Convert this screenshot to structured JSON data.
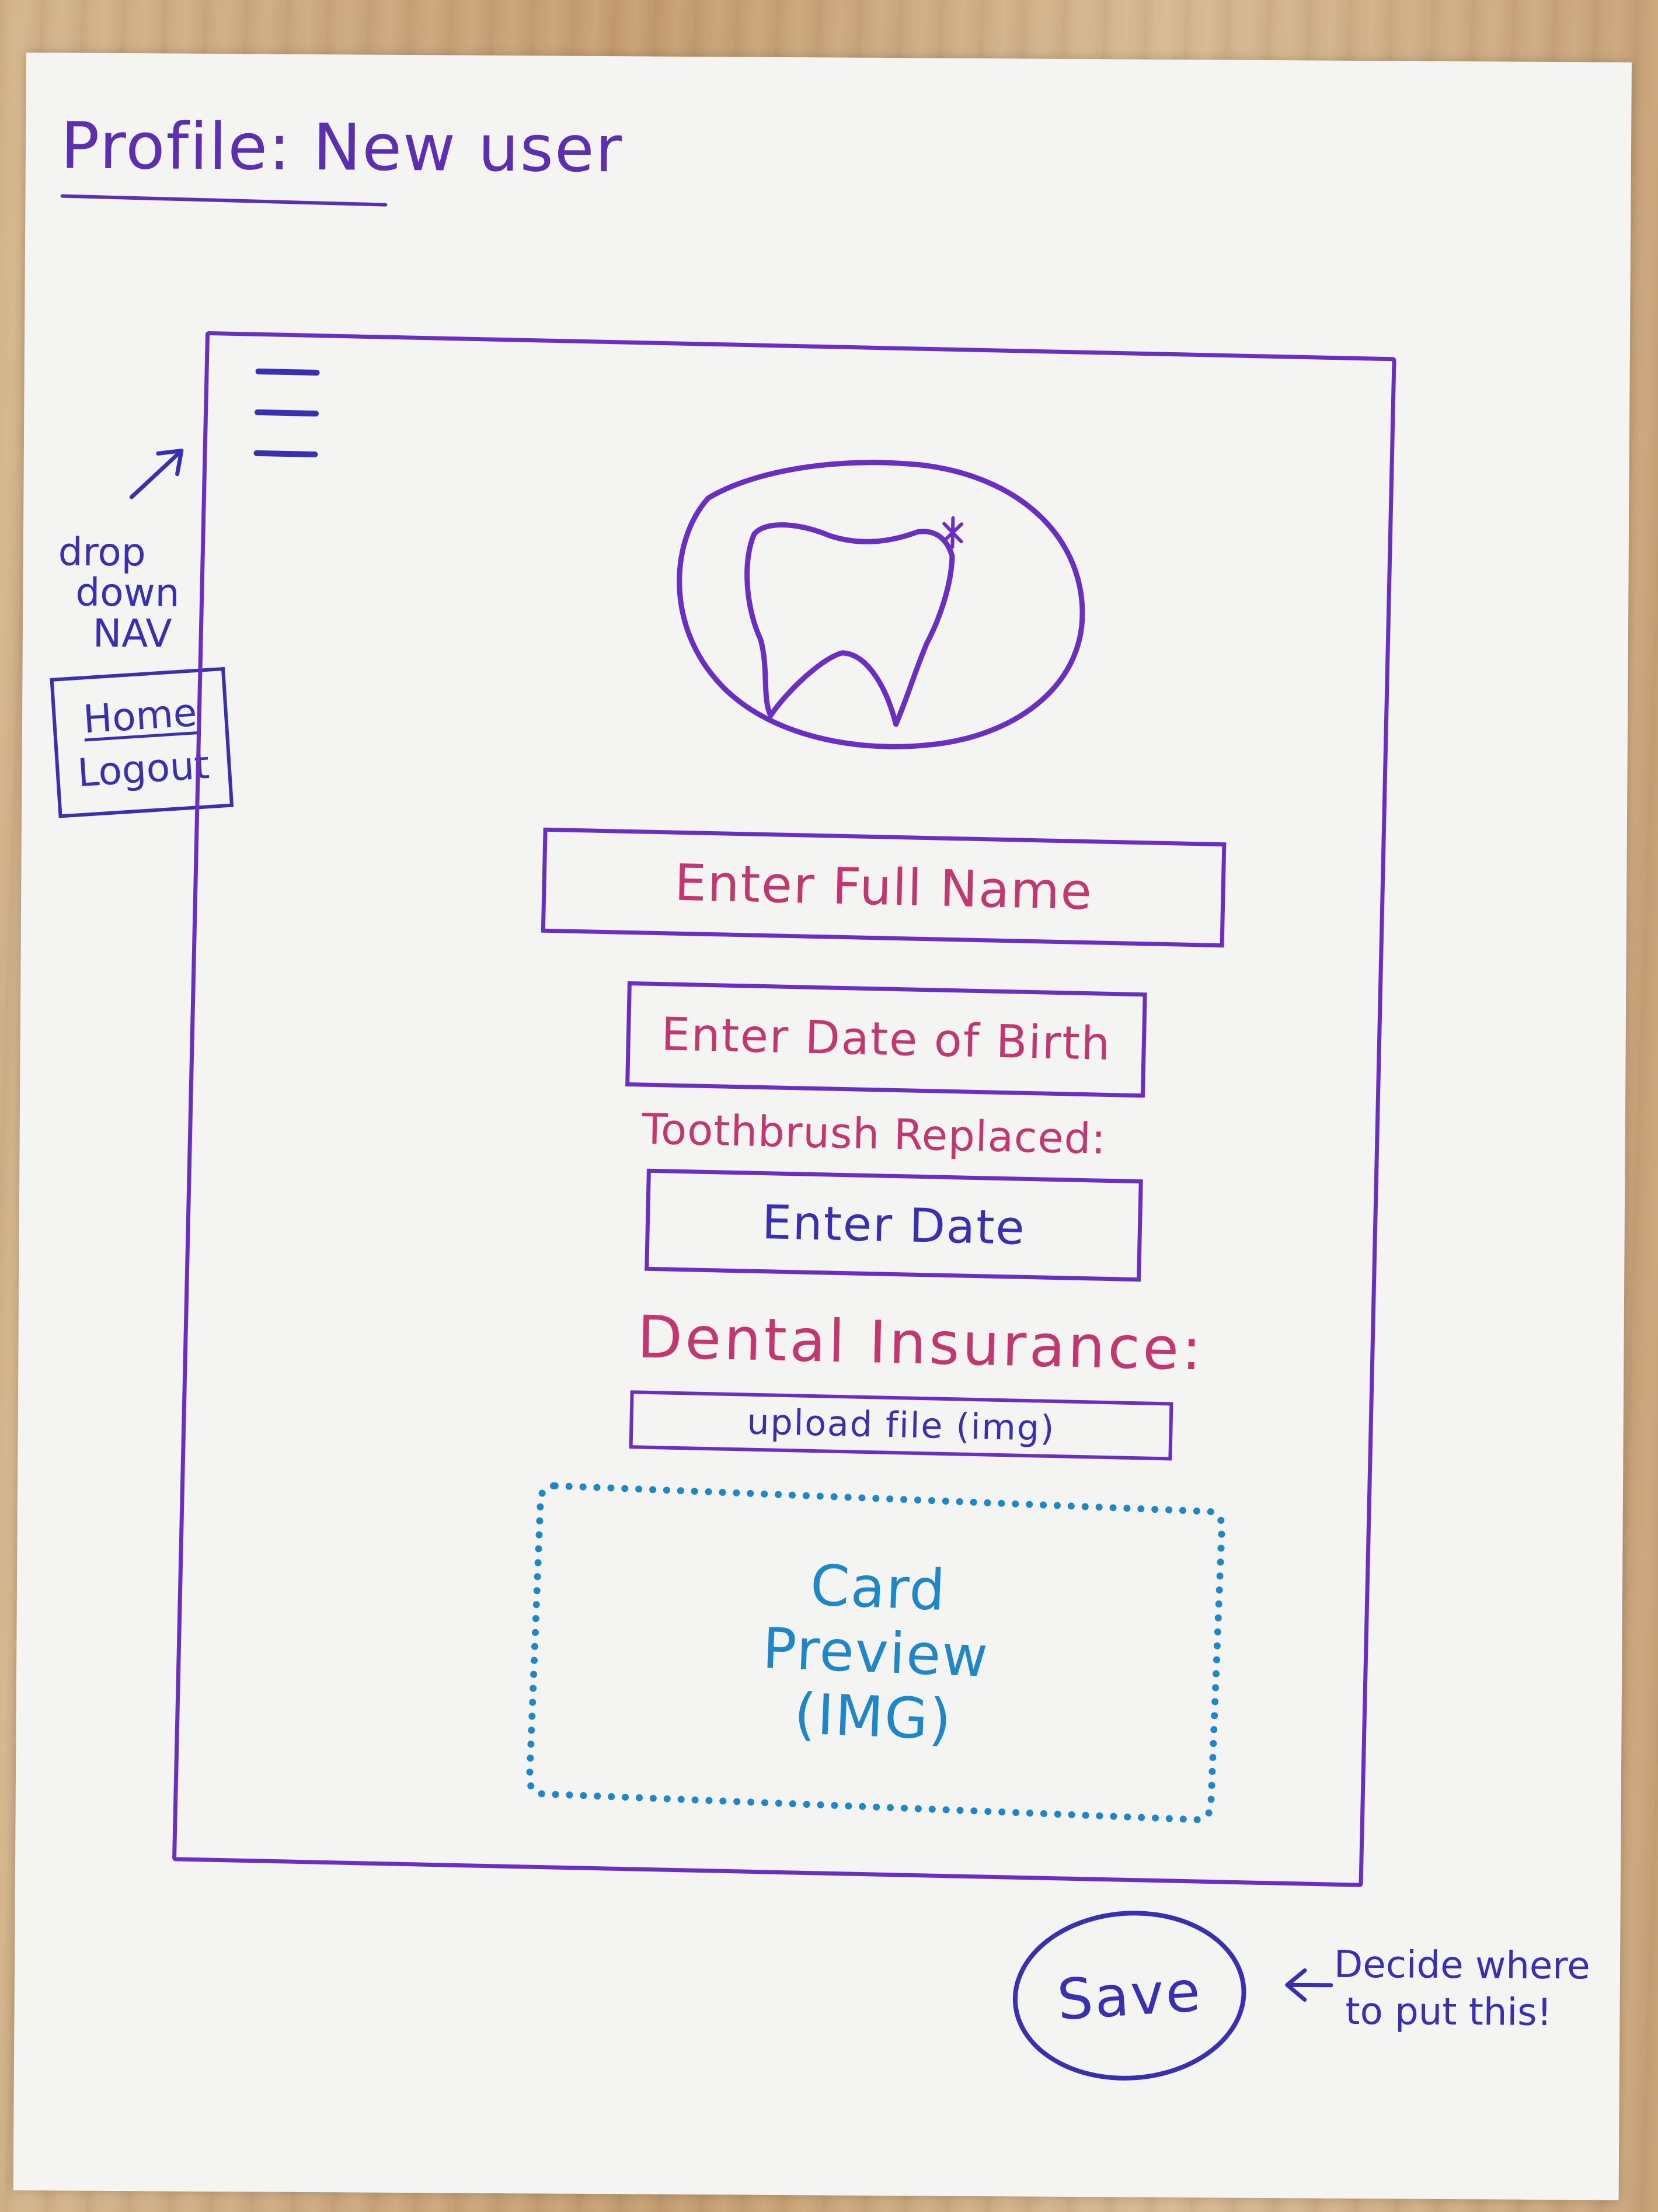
{
  "page": {
    "title": "Profile: New user"
  },
  "header": {
    "menu_icon": "hamburger-icon"
  },
  "logo": {
    "icon": "tooth-icon"
  },
  "form": {
    "full_name_placeholder": "Enter Full Name",
    "dob_placeholder": "Enter Date of Birth",
    "toothbrush_label": "Toothbrush Replaced:",
    "toothbrush_date_placeholder": "Enter Date",
    "insurance_label": "Dental Insurance:",
    "upload_label": "upload file (img)",
    "preview_lines": [
      "Card",
      "Preview",
      "(IMG)"
    ]
  },
  "annotations": {
    "nav_note_lines": [
      "drop",
      "down",
      "NAV"
    ],
    "nav_items": [
      "Home",
      "Logout"
    ],
    "save_note_lines": [
      "Decide where",
      "to put this!"
    ]
  },
  "actions": {
    "save_label": "Save"
  },
  "colors": {
    "frame": "#6a2fc2",
    "ink_blue": "#3a2fb0",
    "ink_pink": "#c2376f",
    "ink_cyan": "#1f86c7",
    "paper": "#f4f4f2"
  }
}
